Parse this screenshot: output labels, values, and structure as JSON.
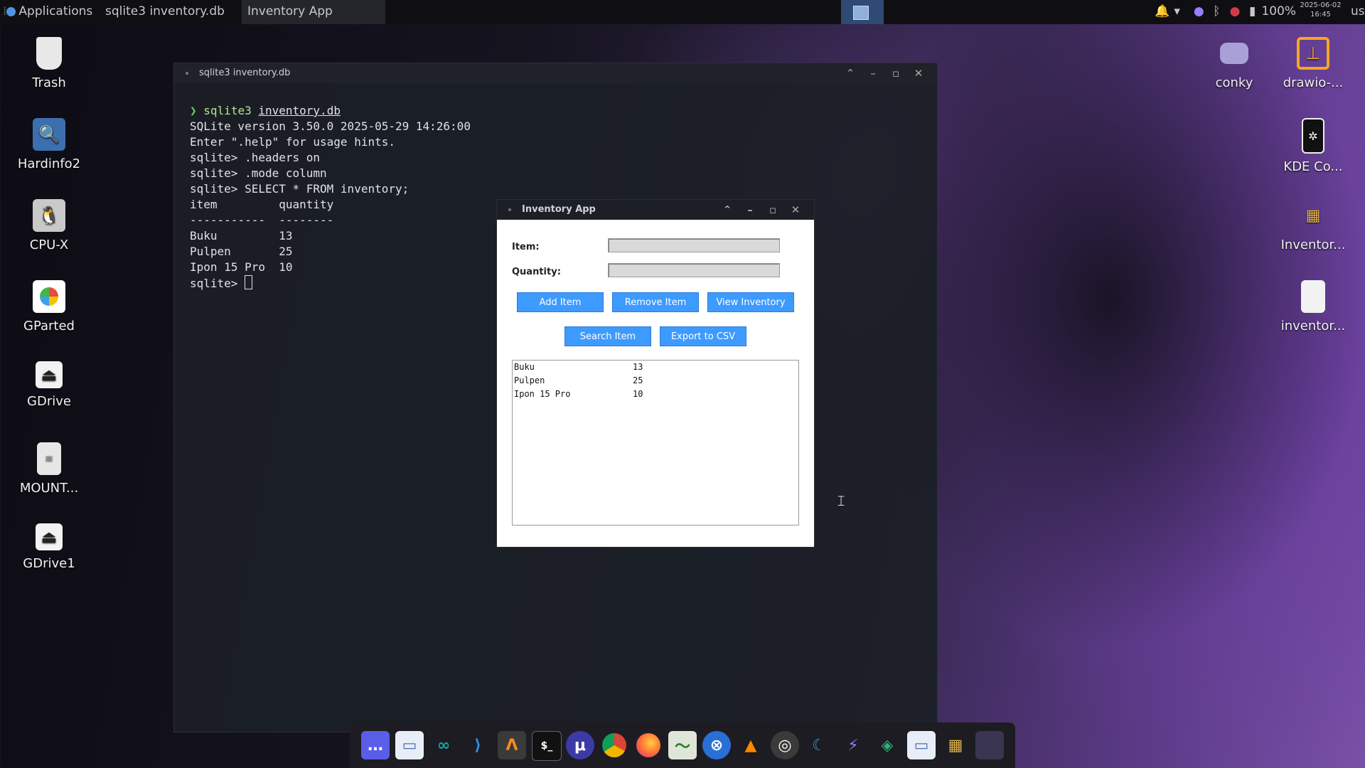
{
  "topbar": {
    "applications": "Applications",
    "tasks": [
      "sqlite3 inventory.db",
      "Inventory App"
    ],
    "battery": "100%",
    "date": "2025-06-02",
    "time": "16:45",
    "user": "user"
  },
  "desktop_left": [
    {
      "label": "Trash",
      "icon": "trash-icon"
    },
    {
      "label": "Hardinfo2",
      "icon": "hardinfo-icon"
    },
    {
      "label": "CPU-X",
      "icon": "tux-icon"
    },
    {
      "label": "GParted",
      "icon": "gparted-icon"
    },
    {
      "label": "GDrive",
      "icon": "drive-icon"
    },
    {
      "label": "MOUNT...",
      "icon": "text-file-icon"
    },
    {
      "label": "GDrive1",
      "icon": "drive-icon"
    }
  ],
  "desktop_right": [
    {
      "label": "conky",
      "icon": "conky-icon"
    },
    {
      "label": "drawio-...",
      "icon": "drawio-icon"
    },
    {
      "label": "KDE Co...",
      "icon": "kde-connect-icon"
    },
    {
      "label": "Inventor...",
      "icon": "inventory-app-icon"
    },
    {
      "label": "inventor...",
      "icon": "file-icon"
    }
  ],
  "terminal": {
    "title": "sqlite3 inventory.db",
    "prompt_symbol": "❯",
    "cmd": "sqlite3",
    "cmd_arg": "inventory.db",
    "lines": [
      "SQLite version 3.50.0 2025-05-29 14:26:00",
      "Enter \".help\" for usage hints.",
      "sqlite> .headers on",
      "sqlite> .mode column",
      "sqlite> SELECT * FROM inventory;",
      "item         quantity",
      "-----------  --------",
      "Buku         13",
      "Pulpen       25",
      "Ipon 15 Pro  10"
    ],
    "last_prompt": "sqlite> "
  },
  "inventory_app": {
    "title": "Inventory App",
    "item_label": "Item:",
    "quantity_label": "Quantity:",
    "item_value": "",
    "quantity_value": "",
    "buttons": {
      "add": "Add Item",
      "remove": "Remove Item",
      "view": "View Inventory",
      "search": "Search Item",
      "export": "Export to CSV"
    },
    "rows": [
      {
        "item": "Buku",
        "qty": "13"
      },
      {
        "item": "Pulpen",
        "qty": "25"
      },
      {
        "item": "Ipon 15 Pro",
        "qty": "10"
      }
    ]
  },
  "dock": [
    "app-grid-icon",
    "files-icon",
    "arduino-icon",
    "vscode-icon",
    "sublime-icon",
    "terminal-icon",
    "utorrent-icon",
    "chrome-icon",
    "firefox-icon",
    "system-monitor-icon",
    "settings-icon",
    "vlc-icon",
    "obs-icon",
    "kde-icon",
    "zapzap-icon",
    "layers-icon",
    "file-manager-icon",
    "inventory-icon",
    "window-icon"
  ],
  "colors": {
    "accent_button": "#3d9bff",
    "panel": "#0f0f13"
  }
}
